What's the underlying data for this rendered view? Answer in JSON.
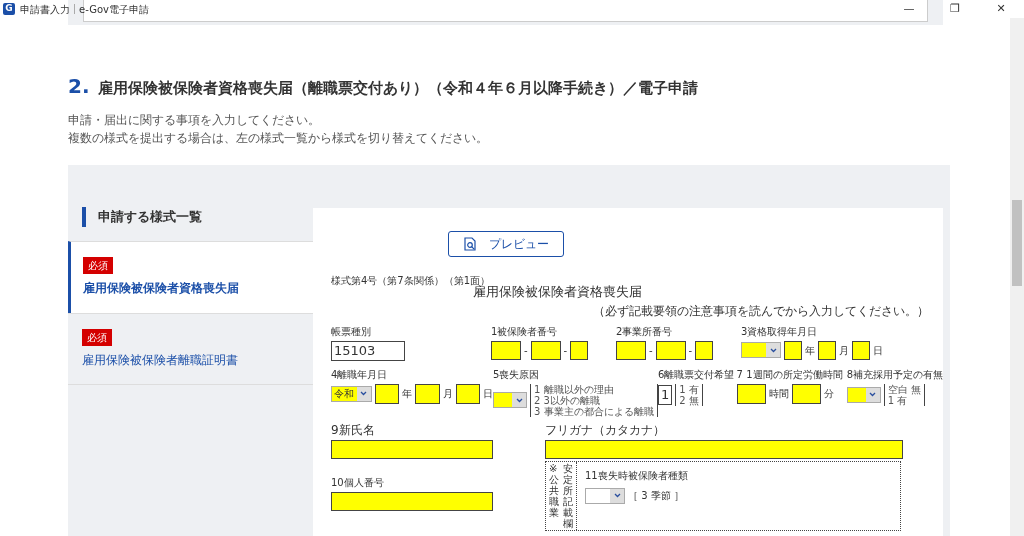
{
  "window": {
    "icon_letter": "G",
    "title": "申請書入力",
    "app": "e-Gov電子申請",
    "controls": [
      "—",
      "❐",
      "✕"
    ]
  },
  "section": {
    "number": "2.",
    "title": "雇用保険被保険者資格喪失届（離職票交付あり）（令和４年６月以降手続き）／電子申請",
    "intro": [
      "申請・届出に関する事項を入力してください。",
      "複数の様式を提出する場合は、左の様式一覧から様式を切り替えてください。"
    ]
  },
  "sidebar": {
    "heading": "申請する様式一覧",
    "items": [
      {
        "badge": "必須",
        "label": "雇用保険被保険者資格喪失届",
        "selected": true
      },
      {
        "badge": "必須",
        "label": "雇用保険被保険者離職証明書",
        "selected": false
      }
    ]
  },
  "preview_button": "プレビュー",
  "form": {
    "form_no": "様式第4号（第7条関係）（第1面）",
    "title": "雇用保険被保険者資格喪失届",
    "note": "（必ず記載要領の注意事項を読んでから入力してください。）",
    "rows": [
      [
        {
          "label": "帳票種別",
          "items": [
            {
              "kind": "plain",
              "value": "15103"
            }
          ]
        },
        {
          "label": "1被保険者番号",
          "items": [
            {
              "kind": "field"
            },
            {
              "kind": "text",
              "text": "-"
            },
            {
              "kind": "field"
            },
            {
              "kind": "text",
              "text": "-"
            },
            {
              "kind": "digit"
            }
          ]
        },
        {
          "label": "2事業所番号",
          "items": [
            {
              "kind": "field"
            },
            {
              "kind": "text",
              "text": "-"
            },
            {
              "kind": "field"
            },
            {
              "kind": "text",
              "text": "-"
            },
            {
              "kind": "digit"
            }
          ]
        },
        {
          "label": "3資格取得年月日",
          "items": [
            {
              "kind": "select"
            },
            {
              "kind": "digit"
            },
            {
              "kind": "text",
              "text": "年"
            },
            {
              "kind": "digit"
            },
            {
              "kind": "text",
              "text": "月"
            },
            {
              "kind": "digit"
            },
            {
              "kind": "text",
              "text": "日"
            }
          ]
        }
      ],
      [
        {
          "label": "4離職年月日",
          "items": [
            {
              "kind": "select",
              "value": "令和"
            },
            {
              "kind": "digit"
            },
            {
              "kind": "text",
              "text": "年"
            },
            {
              "kind": "digit"
            },
            {
              "kind": "text",
              "text": "月"
            },
            {
              "kind": "digit"
            },
            {
              "kind": "text",
              "text": "日"
            }
          ]
        },
        {
          "label": "5喪失原因",
          "items": [
            {
              "kind": "select"
            },
            {
              "kind": "bracket",
              "lines": [
                "1 離職以外の理由",
                "2 3以外の離職",
                "3 事業主の都合による離職"
              ]
            }
          ]
        },
        {
          "label": "6離職票交付希望",
          "items": [
            {
              "kind": "plain",
              "value": "1"
            },
            {
              "kind": "bracket",
              "lines": [
                "1 有",
                "2 無"
              ]
            }
          ]
        },
        {
          "label": "7 1週間の所定労働時間",
          "items": [
            {
              "kind": "digit"
            },
            {
              "kind": "text",
              "text": "時間"
            },
            {
              "kind": "digit"
            },
            {
              "kind": "text",
              "text": "分"
            }
          ]
        },
        {
          "label": "8補充採用予定の有無",
          "items": [
            {
              "kind": "select"
            },
            {
              "kind": "bracket",
              "lines": [
                "空白 無",
                "1 有"
              ]
            }
          ]
        }
      ],
      [
        {
          "label": "9新氏名",
          "items": [
            {
              "kind": "long"
            }
          ]
        },
        {
          "label": "フリガナ（カタカナ）",
          "items": [
            {
              "kind": "long"
            }
          ]
        }
      ]
    ],
    "personal": {
      "label": "10個人番号"
    },
    "office_box": {
      "side": [
        "※公共職業",
        "安定所記載欄"
      ],
      "label": "11喪失時被保険者種類",
      "option_text": "［ 3 季節 ］"
    }
  }
}
